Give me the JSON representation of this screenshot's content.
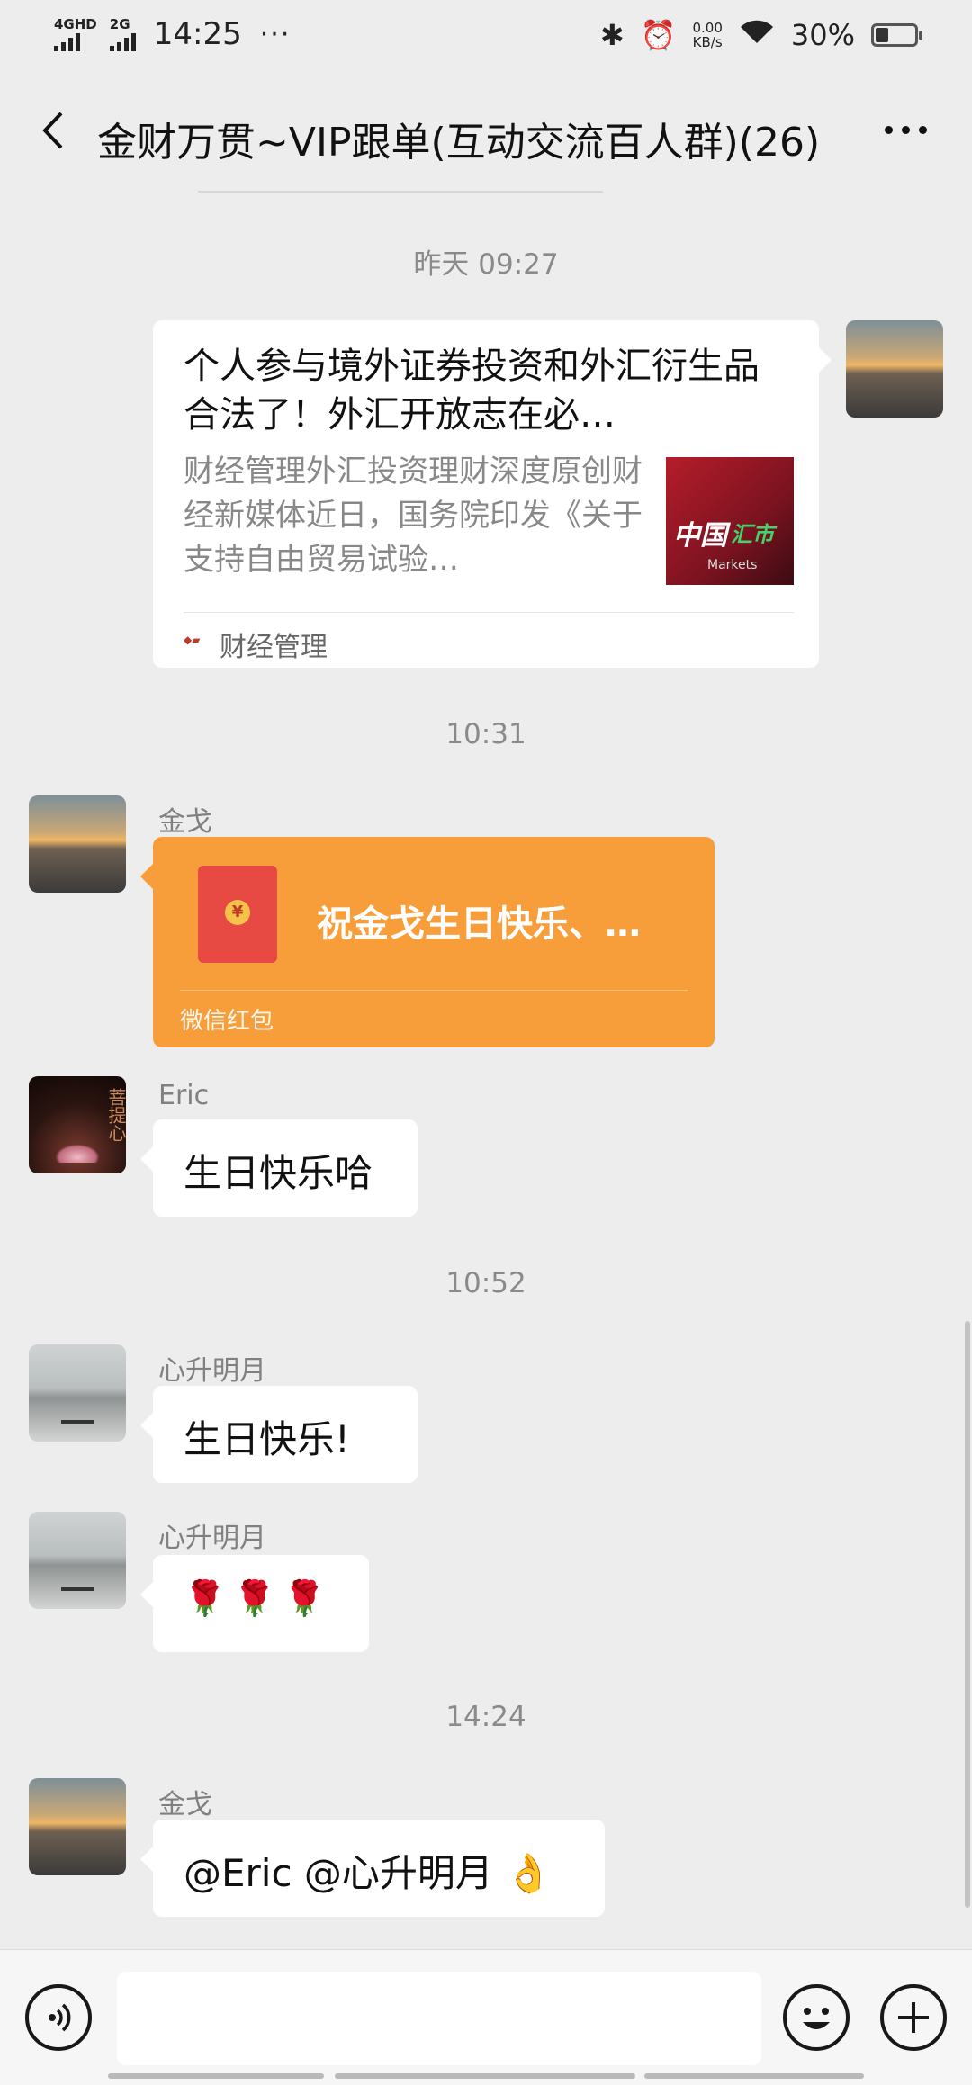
{
  "status_bar": {
    "network1": "4GHD",
    "network2": "2G",
    "time": "14:25",
    "dots": "···",
    "speed_value": "0.00",
    "speed_unit": "KB/s",
    "battery": "30%"
  },
  "header": {
    "title": "金财万贯~VIP跟单(互动交流百人群)(26)"
  },
  "messages": {
    "time1": "昨天 09:27",
    "card": {
      "title": "个人参与境外证券投资和外汇衍生品合法了！外汇开放志在必…",
      "description": "财经管理外汇投资理财深度原创财经新媒体近日，国务院印发《关于支持自由贸易试验…",
      "thumb_text1": "中国",
      "thumb_text2": "汇市",
      "thumb_text3": "Markets",
      "source": "财经管理"
    },
    "time2": "10:31",
    "redpacket": {
      "sender": "金戈",
      "coin": "¥",
      "text": "祝金戈生日快乐、…",
      "label": "微信红包"
    },
    "eric": {
      "sender": "Eric",
      "avatar_text": "菩提心",
      "text": "生日快乐哈"
    },
    "time3": "10:52",
    "xin1": {
      "sender": "心升明月",
      "text": "生日快乐!"
    },
    "xin2": {
      "sender": "心升明月",
      "text": "🌹🌹🌹"
    },
    "time4": "14:24",
    "jinge2": {
      "sender": "金戈",
      "text": "@Eric @心升明月 👌"
    }
  },
  "colors": {
    "background": "#ededed",
    "redpacket": "#f79e3b",
    "envelope": "#e64a42"
  }
}
